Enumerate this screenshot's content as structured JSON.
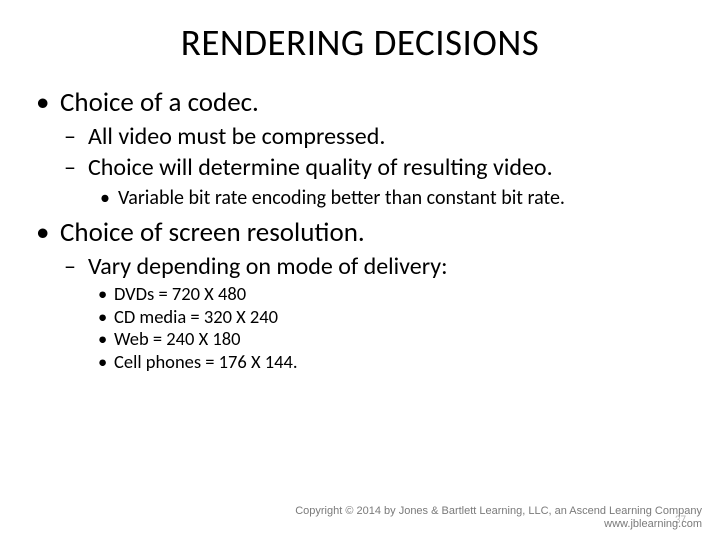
{
  "title": "RENDERING DECISIONS",
  "bullets": {
    "b1": "Choice of a codec.",
    "b1_1": "All video must be compressed.",
    "b1_2": "Choice will determine quality of resulting video.",
    "b1_2_1": "Variable bit rate encoding better than constant bit rate.",
    "b2": "Choice of screen resolution.",
    "b2_1": "Vary depending on mode of delivery:",
    "b2_1_1": "DVDs = 720 X 480",
    "b2_1_2": "CD media = 320 X 240",
    "b2_1_3": "Web = 240 X 180",
    "b2_1_4": "Cell phones = 176 X 144."
  },
  "footer": {
    "line1": "Copyright © 2014 by Jones & Bartlett Learning, LLC, an Ascend Learning Company",
    "line2": "www.jblearning.com"
  },
  "page_number": "37"
}
